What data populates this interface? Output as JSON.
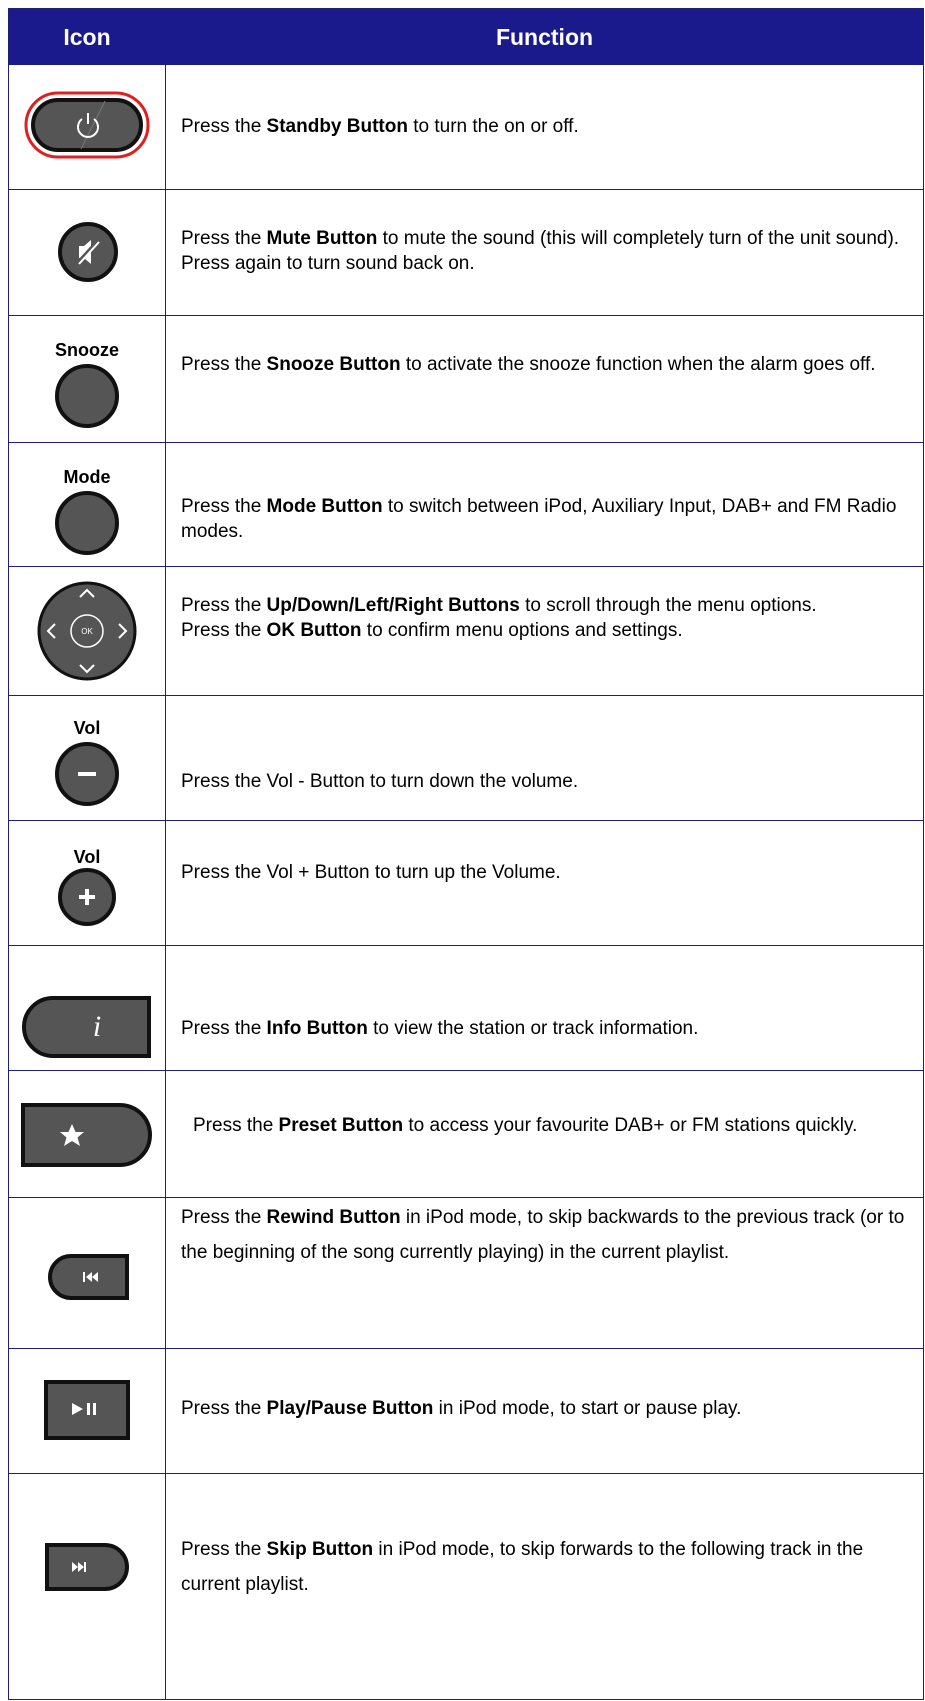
{
  "header": {
    "icon_label": "Icon",
    "function_label": "Function"
  },
  "rows": [
    {
      "icon": "power-icon",
      "pre": "Press the ",
      "bold": "Standby Button",
      "post": " to turn the on or off."
    },
    {
      "icon": "mute-icon",
      "pre": "Press the ",
      "bold": "Mute Button",
      "post": " to mute the sound (this will completely turn of the unit sound). Press again to turn sound back on."
    },
    {
      "icon": "snooze-icon",
      "label": "Snooze",
      "pre": "Press the ",
      "bold": "Snooze Button",
      "post": " to activate the snooze function when the alarm goes off."
    },
    {
      "icon": "mode-icon",
      "label": "Mode",
      "pre": "Press the ",
      "bold": "Mode Button",
      "post": " to switch between iPod, Auxiliary Input, DAB+ and FM Radio modes."
    },
    {
      "icon": "dpad-icon",
      "ok_text": "OK",
      "pre": "Press the ",
      "bold": "Up/Down/Left/Right Buttons",
      "post": " to scroll through the menu options.",
      "pre2": "Press the ",
      "bold2": "OK Button",
      "post2": " to confirm menu options and settings."
    },
    {
      "icon": "minus-icon",
      "label": "Vol",
      "text": "Press the Vol - Button to turn down the volume."
    },
    {
      "icon": "plus-icon",
      "label": "Vol",
      "text": "Press the Vol + Button to turn up the Volume."
    },
    {
      "icon": "info-icon",
      "glyph": "i",
      "pre": "Press the ",
      "bold": "Info Button",
      "post": " to view the station or track information."
    },
    {
      "icon": "star-icon",
      "pre": "Press the ",
      "bold": "Preset Button",
      "post": " to access your favourite DAB+ or FM stations quickly."
    },
    {
      "icon": "rewind-icon",
      "pre": "Press the ",
      "bold": "Rewind Button",
      "post": " in iPod mode, to skip backwards to the previous track (or to the beginning of the song currently playing) in the current playlist."
    },
    {
      "icon": "play-pause-icon",
      "pre": "Press the ",
      "bold": "Play/Pause Button",
      "post": " in iPod mode, to start or pause play."
    },
    {
      "icon": "skip-icon",
      "pre": "Press the ",
      "bold": "Skip Button",
      "post": " in iPod mode, to skip forwards to the following track in the current playlist."
    }
  ]
}
